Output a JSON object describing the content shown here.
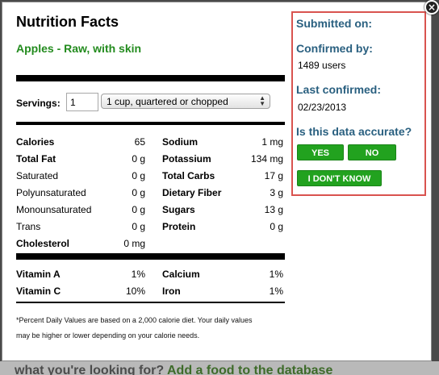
{
  "backdrop": {
    "text_dark": "what you're looking for?",
    "text_green": "Add a food to the database"
  },
  "modal": {
    "close_glyph": "×",
    "title": "Nutrition Facts",
    "food_name": "Apples - Raw, with skin",
    "servings": {
      "label": "Servings:",
      "value": "1",
      "unit": "1 cup, quartered or chopped"
    },
    "nutrients_left": [
      {
        "label": "Calories",
        "value": "65",
        "bold": true
      },
      {
        "label": "Total Fat",
        "value": "0 g",
        "bold": true
      },
      {
        "label": "Saturated",
        "value": "0 g",
        "bold": false
      },
      {
        "label": "Polyunsaturated",
        "value": "0 g",
        "bold": false
      },
      {
        "label": "Monounsaturated",
        "value": "0 g",
        "bold": false
      },
      {
        "label": "Trans",
        "value": "0 g",
        "bold": false
      },
      {
        "label": "Cholesterol",
        "value": "0 mg",
        "bold": true
      }
    ],
    "nutrients_right": [
      {
        "label": "Sodium",
        "value": "1 mg",
        "bold": true
      },
      {
        "label": "Potassium",
        "value": "134 mg",
        "bold": true
      },
      {
        "label": "Total Carbs",
        "value": "17 g",
        "bold": true
      },
      {
        "label": "Dietary Fiber",
        "value": "3 g",
        "bold": true
      },
      {
        "label": "Sugars",
        "value": "13 g",
        "bold": true
      },
      {
        "label": "Protein",
        "value": "0 g",
        "bold": true
      }
    ],
    "vitamins": [
      {
        "label": "Vitamin A",
        "value": "1%"
      },
      {
        "label": "Vitamin C",
        "value": "10%"
      },
      {
        "label": "Calcium",
        "value": "1%"
      },
      {
        "label": "Iron",
        "value": "1%"
      }
    ],
    "footnote": "*Percent Daily Values are based on a 2,000 calorie diet. Your daily values may be higher or lower depending on your calorie needs."
  },
  "panel": {
    "submitted_label": "Submitted on:",
    "confirmed_label": "Confirmed by:",
    "confirmed_value": "1489 users",
    "last_confirmed_label": "Last confirmed:",
    "last_confirmed_value": "02/23/2013",
    "accuracy_question": "Is this data accurate?",
    "yes_label": "YES",
    "no_label": "NO",
    "dont_know_label": "I DON'T KNOW"
  },
  "colors": {
    "food_green": "#238b1e",
    "heading_blue": "#2a6080",
    "panel_border": "#d9534f",
    "button_green": "#22a21f"
  }
}
